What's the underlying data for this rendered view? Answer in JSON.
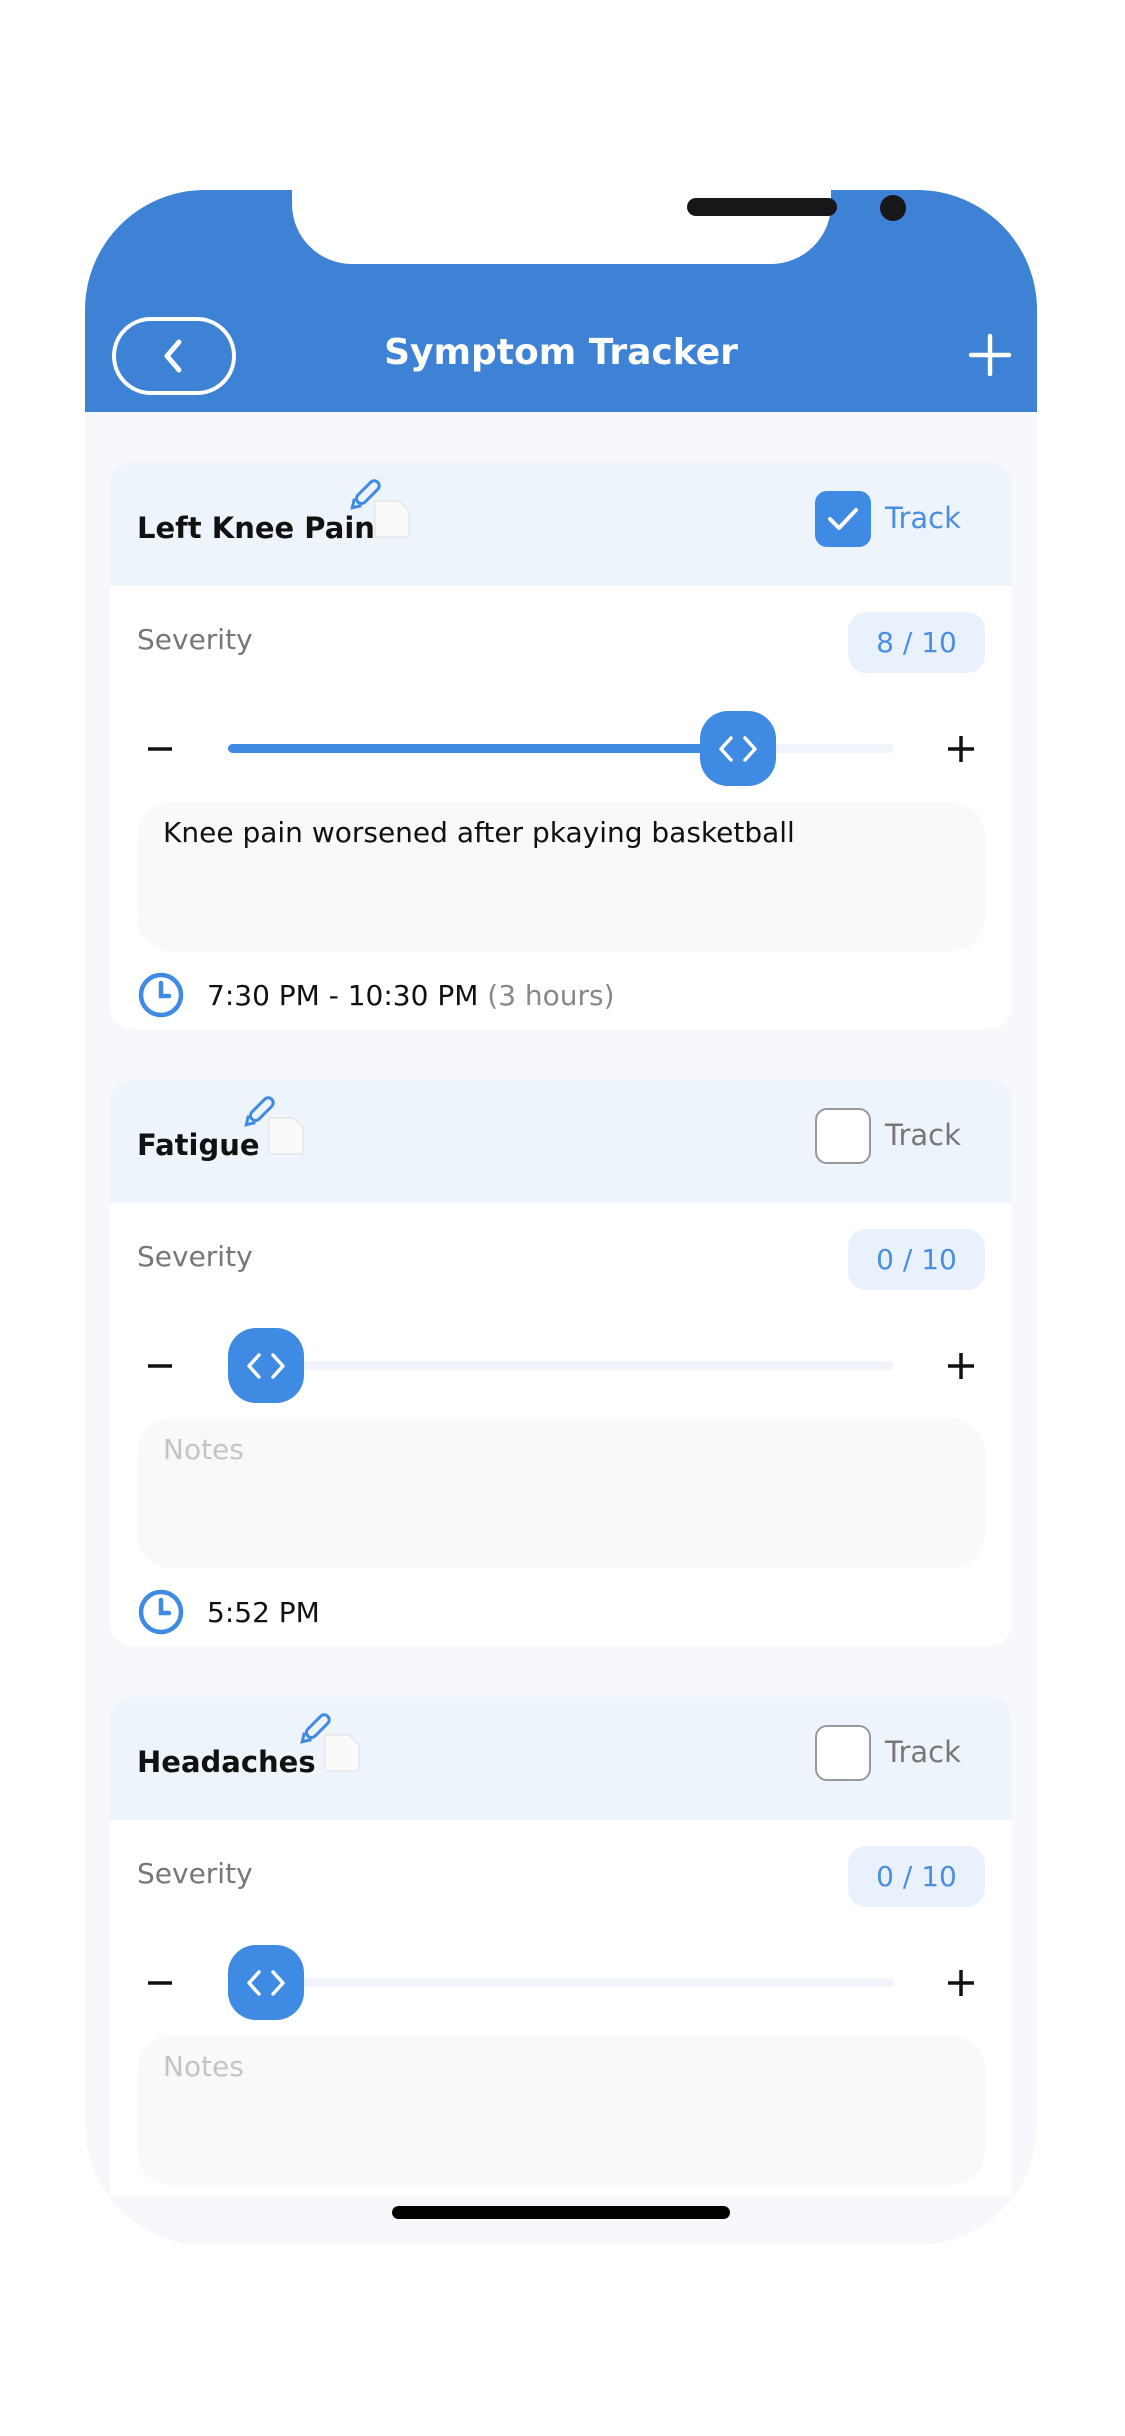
{
  "header": {
    "title": "Symptom Tracker",
    "back_icon": "chevron-left-icon",
    "add_icon": "plus-icon"
  },
  "colors": {
    "header": "#3d82d4",
    "accent": "#3f8ae2"
  },
  "symptoms": [
    {
      "name": "Left Knee Pain",
      "track_label": "Track",
      "tracked": true,
      "severity_label": "Severity",
      "severity": 8,
      "max": 10,
      "severity_text": "8 / 10",
      "notes": "Knee pain worsened after pkaying basketball",
      "notes_placeholder": "Notes",
      "time": "7:30 PM - 10:30 PM",
      "duration": "(3 hours)"
    },
    {
      "name": "Fatigue",
      "track_label": "Track",
      "tracked": false,
      "severity_label": "Severity",
      "severity": 0,
      "max": 10,
      "severity_text": "0 / 10",
      "notes": "",
      "notes_placeholder": "Notes",
      "time": "5:52 PM",
      "duration": ""
    },
    {
      "name": "Headaches",
      "track_label": "Track",
      "tracked": false,
      "severity_label": "Severity",
      "severity": 0,
      "max": 10,
      "severity_text": "0 / 10",
      "notes": "",
      "notes_placeholder": "Notes"
    }
  ]
}
